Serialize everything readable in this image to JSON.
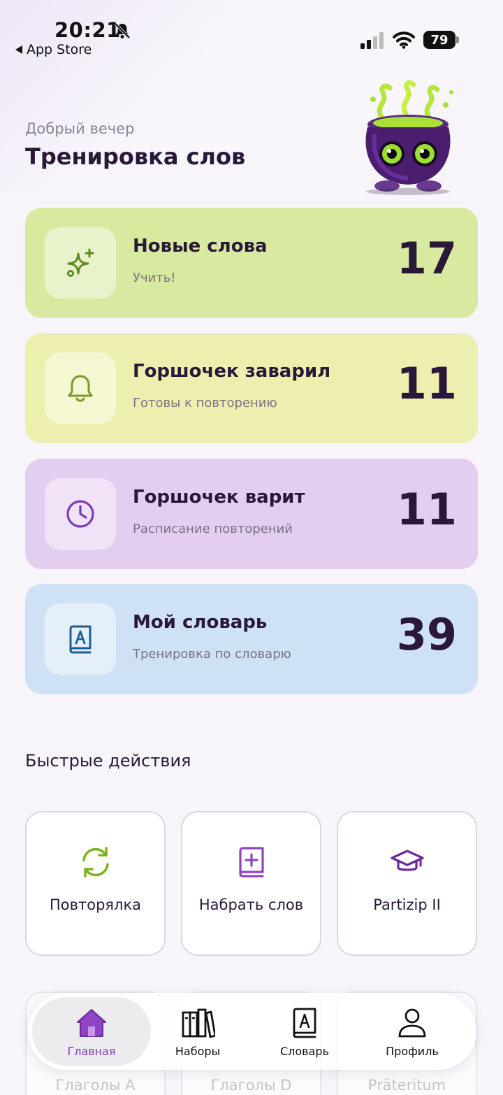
{
  "status_bar": {
    "time": "20:21",
    "back_label": "App Store",
    "battery": "79"
  },
  "header": {
    "greeting": "Добрый вечер",
    "title": "Тренировка слов"
  },
  "cards": [
    {
      "title": "Новые слова",
      "subtitle": "Учить!",
      "count": "17",
      "icon": "sparkles-icon",
      "color": "#d8eaa0",
      "icon_color": "#5e8a1e"
    },
    {
      "title": "Горшочек заварил",
      "subtitle": "Готовы к повторению",
      "count": "11",
      "icon": "bell-icon",
      "color": "#edefae",
      "icon_color": "#7a9a2a"
    },
    {
      "title": "Горшочек варит",
      "subtitle": "Расписание повторений",
      "count": "11",
      "icon": "clock-icon",
      "color": "#e3cdf1",
      "icon_color": "#7b3bb8"
    },
    {
      "title": "Мой словарь",
      "subtitle": "Тренировка по словарю",
      "count": "39",
      "icon": "dictionary-icon",
      "color": "#cfe2f5",
      "icon_color": "#1e5f8f"
    }
  ],
  "quick_actions": {
    "title": "Быстрые действия",
    "items": [
      {
        "label": "Повторялка",
        "icon": "refresh-icon"
      },
      {
        "label": "Набрать слов",
        "icon": "add-book-icon"
      },
      {
        "label": "Partizip II",
        "icon": "graduation-cap-icon"
      }
    ],
    "partial_items": [
      {
        "label": "Глаголы А"
      },
      {
        "label": "Глаголы D"
      },
      {
        "label": "Präteritum"
      }
    ]
  },
  "bottom_nav": {
    "items": [
      {
        "label": "Главная",
        "icon": "home-icon",
        "active": true
      },
      {
        "label": "Наборы",
        "icon": "books-icon",
        "active": false
      },
      {
        "label": "Словарь",
        "icon": "dictionary-icon",
        "active": false
      },
      {
        "label": "Профиль",
        "icon": "profile-icon",
        "active": false
      }
    ]
  }
}
